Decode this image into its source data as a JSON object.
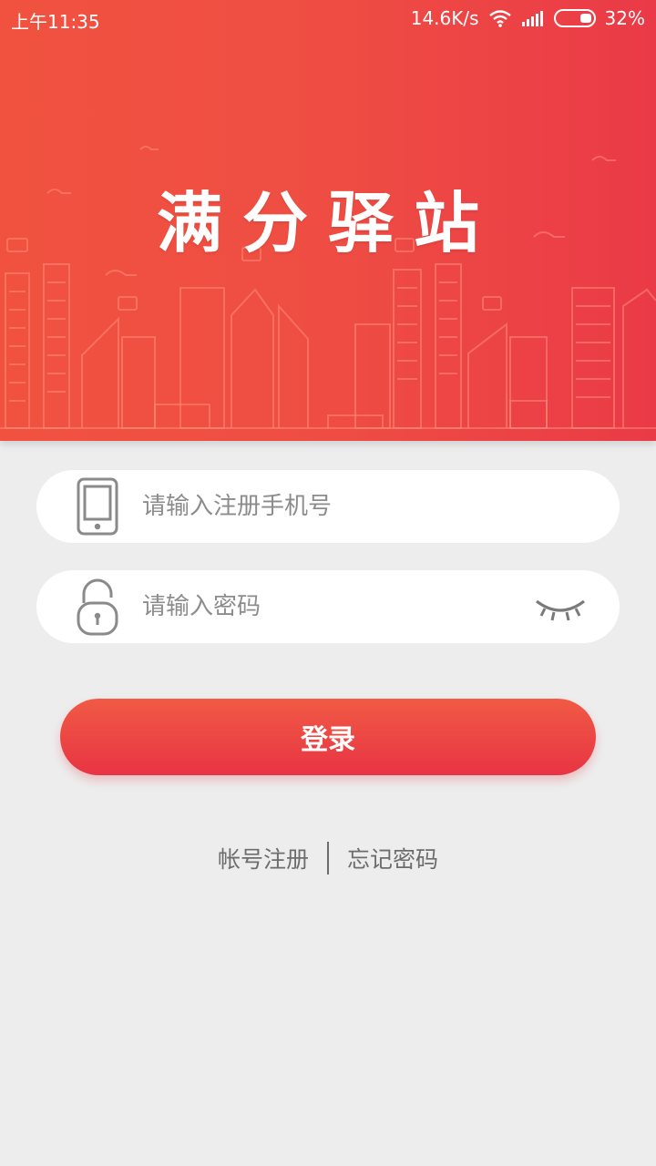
{
  "status_bar": {
    "time": "上午11:35",
    "speed": "14.6K/s",
    "battery": "32%",
    "battery_level": 0.32
  },
  "app": {
    "title": "满分驿站"
  },
  "form": {
    "phone_placeholder": "请输入注册手机号",
    "phone_value": "",
    "password_placeholder": "请输入密码",
    "password_value": "",
    "login_label": "登录"
  },
  "links": {
    "register": "帐号注册",
    "forgot": "忘记密码"
  },
  "colors": {
    "brand_red": "#ef4d43",
    "button_top": "#f05a44",
    "button_bottom": "#e83444",
    "page_bg": "#ededed"
  }
}
